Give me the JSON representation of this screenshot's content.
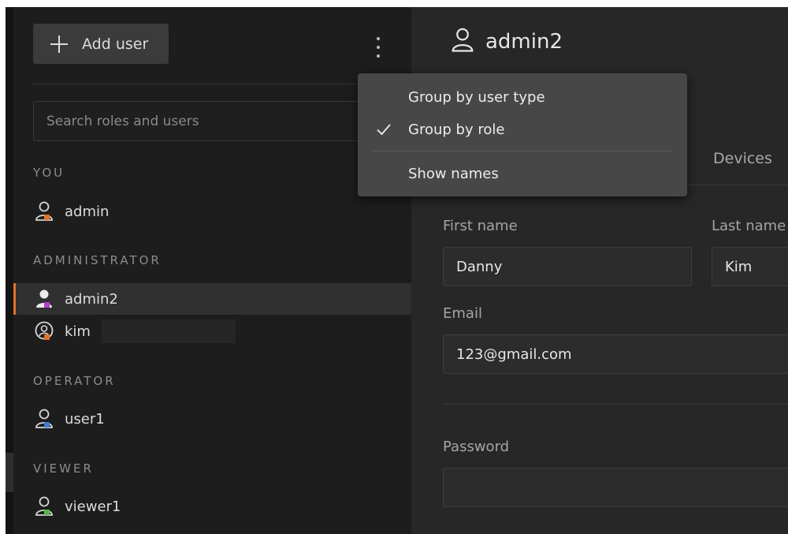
{
  "sidebar": {
    "add_user_label": "Add user",
    "search_placeholder": "Search roles and users",
    "sections": [
      {
        "label": "YOU",
        "users": [
          {
            "name": "admin",
            "badge_color": "#e07328"
          }
        ]
      },
      {
        "label": "ADMINISTRATOR",
        "users": [
          {
            "name": "admin2",
            "badge_color": "#b23ccc",
            "selected": true
          },
          {
            "name": "kim",
            "badge_color": "#e07328"
          }
        ]
      },
      {
        "label": "OPERATOR",
        "users": [
          {
            "name": "user1",
            "badge_color": "#3e7ccf"
          }
        ]
      },
      {
        "label": "VIEWER",
        "users": [
          {
            "name": "viewer1",
            "badge_color": "#57b84a"
          }
        ]
      }
    ],
    "selected_accent": "#e07328"
  },
  "main": {
    "title": "admin2",
    "tab_devices": "Devices",
    "first_name_label": "First name",
    "first_name_value": "Danny",
    "last_name_label": "Last name",
    "last_name_value": "Kim",
    "email_label": "Email",
    "email_value": "123@gmail.com",
    "password_label": "Password",
    "password_value": ""
  },
  "menu": {
    "items": [
      {
        "label": "Group by user type",
        "checked": false
      },
      {
        "label": "Group by role",
        "checked": true
      },
      {
        "label": "Show names",
        "checked": false
      }
    ]
  }
}
